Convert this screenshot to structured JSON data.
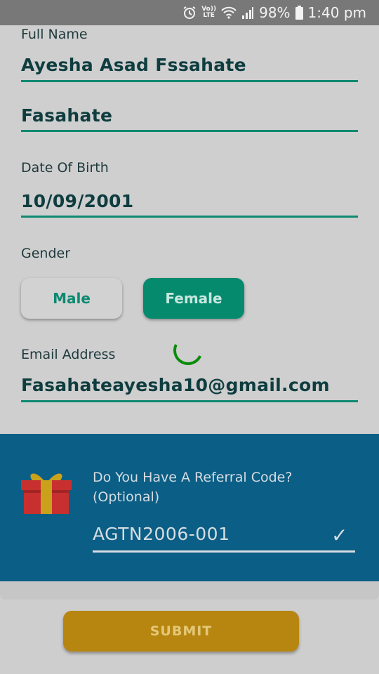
{
  "status_bar": {
    "volte_top": "Vo))",
    "volte_bottom": "LTE",
    "battery": "98%",
    "time": "1:40 pm"
  },
  "form": {
    "full_name_label": "Full Name",
    "first_name": "Ayesha Asad Fssahate",
    "last_name": "Fasahate",
    "dob_label": "Date Of Birth",
    "dob": "10/09/2001",
    "gender_label": "Gender",
    "gender_options": [
      "Male",
      "Female"
    ],
    "gender_selected": "Female",
    "email_label": "Email Address",
    "email": "Fasahateayesha10@gmail.com"
  },
  "referral": {
    "question_line1": "Do You Have A Referral Code?",
    "question_line2": "(Optional)",
    "code": "AGTN2006-001"
  },
  "submit_label": "SUBMIT",
  "colors": {
    "accent": "#058a6e",
    "referral_bg": "#0b5e85",
    "submit": "#b78610"
  }
}
